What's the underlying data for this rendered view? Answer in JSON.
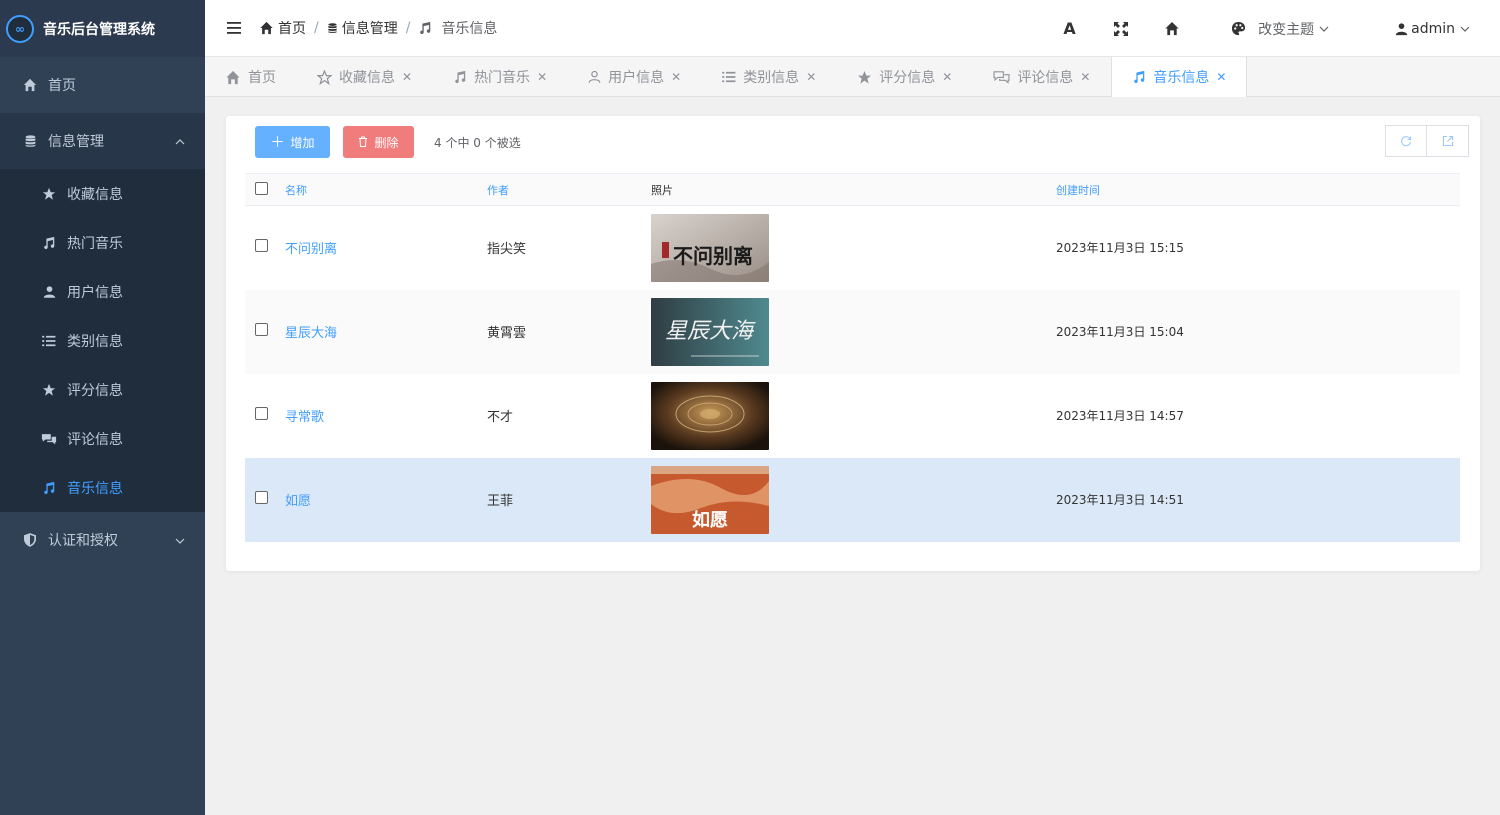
{
  "app": {
    "title": "音乐后台管理系统",
    "logo_text": "∞"
  },
  "sidebar": {
    "home": "首页",
    "info_group": "信息管理",
    "sub_items": [
      {
        "label": "收藏信息",
        "icon": "star-icon"
      },
      {
        "label": "热门音乐",
        "icon": "music-icon"
      },
      {
        "label": "用户信息",
        "icon": "user-icon"
      },
      {
        "label": "类别信息",
        "icon": "list-icon"
      },
      {
        "label": "评分信息",
        "icon": "star-icon"
      },
      {
        "label": "评论信息",
        "icon": "comments-icon"
      },
      {
        "label": "音乐信息",
        "icon": "music-icon",
        "active": true
      }
    ],
    "auth_group": "认证和授权"
  },
  "header": {
    "breadcrumb": [
      "首页",
      "信息管理",
      "音乐信息"
    ],
    "breadcrumb_sep": "/",
    "font_icon_label": "A",
    "theme_label": "改变主题",
    "user": "admin"
  },
  "tabs": [
    {
      "label": "首页",
      "closable": false
    },
    {
      "label": "收藏信息",
      "closable": true
    },
    {
      "label": "热门音乐",
      "closable": true
    },
    {
      "label": "用户信息",
      "closable": true
    },
    {
      "label": "类别信息",
      "closable": true
    },
    {
      "label": "评分信息",
      "closable": true
    },
    {
      "label": "评论信息",
      "closable": true
    },
    {
      "label": "音乐信息",
      "closable": true,
      "active": true
    }
  ],
  "toolbar": {
    "add_label": "增加",
    "delete_label": "删除",
    "selection_text": "4 个中 0 个被选"
  },
  "table": {
    "columns": [
      "名称",
      "作者",
      "照片",
      "创建时间"
    ],
    "rows": [
      {
        "name": "不问别离",
        "author": "指尖笑",
        "created": "2023年11月3日 15:15",
        "cover_text": "不问别离"
      },
      {
        "name": "星辰大海",
        "author": "黄霄雲",
        "created": "2023年11月3日 15:04",
        "cover_text": "星辰大海"
      },
      {
        "name": "寻常歌",
        "author": "不才",
        "created": "2023年11月3日 14:57",
        "cover_text": ""
      },
      {
        "name": "如愿",
        "author": "王菲",
        "created": "2023年11月3日 14:51",
        "cover_text": "如愿"
      }
    ]
  },
  "colors": {
    "sidebar_bg": "#304156",
    "accent": "#409eff",
    "danger": "#f07c7c",
    "selected_row": "#dbe8f7"
  }
}
